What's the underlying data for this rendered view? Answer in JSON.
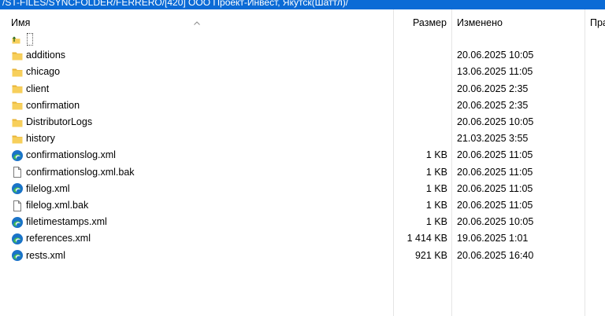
{
  "path": "/ST-FILES/SYNCFOLDER/FERRERO/[420] ООО Проект-Инвест, Якутск(Шаттл)/",
  "columns": {
    "name": "Имя",
    "size": "Размер",
    "modified": "Изменено",
    "rights": "Пра"
  },
  "files": [
    {
      "icon": "parent-folder-icon",
      "name": "..",
      "size": "",
      "modified": ""
    },
    {
      "icon": "folder-icon",
      "name": "additions",
      "size": "",
      "modified": "20.06.2025 10:05"
    },
    {
      "icon": "folder-icon",
      "name": "chicago",
      "size": "",
      "modified": "13.06.2025 11:05"
    },
    {
      "icon": "folder-icon",
      "name": "client",
      "size": "",
      "modified": "20.06.2025 2:35"
    },
    {
      "icon": "folder-icon",
      "name": "confirmation",
      "size": "",
      "modified": "20.06.2025 2:35"
    },
    {
      "icon": "folder-icon",
      "name": "DistributorLogs",
      "size": "",
      "modified": "20.06.2025 10:05"
    },
    {
      "icon": "folder-icon",
      "name": "history",
      "size": "",
      "modified": "21.03.2025 3:55"
    },
    {
      "icon": "edge-xml-icon",
      "name": "confirmationslog.xml",
      "size": "1 KB",
      "modified": "20.06.2025 11:05"
    },
    {
      "icon": "blank-file-icon",
      "name": "confirmationslog.xml.bak",
      "size": "1 KB",
      "modified": "20.06.2025 11:05"
    },
    {
      "icon": "edge-xml-icon",
      "name": "filelog.xml",
      "size": "1 KB",
      "modified": "20.06.2025 11:05"
    },
    {
      "icon": "blank-file-icon",
      "name": "filelog.xml.bak",
      "size": "1 KB",
      "modified": "20.06.2025 11:05"
    },
    {
      "icon": "edge-xml-icon",
      "name": "filetimestamps.xml",
      "size": "1 KB",
      "modified": "20.06.2025 10:05"
    },
    {
      "icon": "edge-xml-icon",
      "name": "references.xml",
      "size": "1 414 KB",
      "modified": "19.06.2025 1:01"
    },
    {
      "icon": "edge-xml-icon",
      "name": "rests.xml",
      "size": "921 KB",
      "modified": "20.06.2025 16:40"
    }
  ],
  "colors": {
    "pathbar": "#0b6bd6",
    "folder": "#f4c542",
    "edge_blue": "#1a73c8",
    "edge_green": "#3bb85a"
  }
}
